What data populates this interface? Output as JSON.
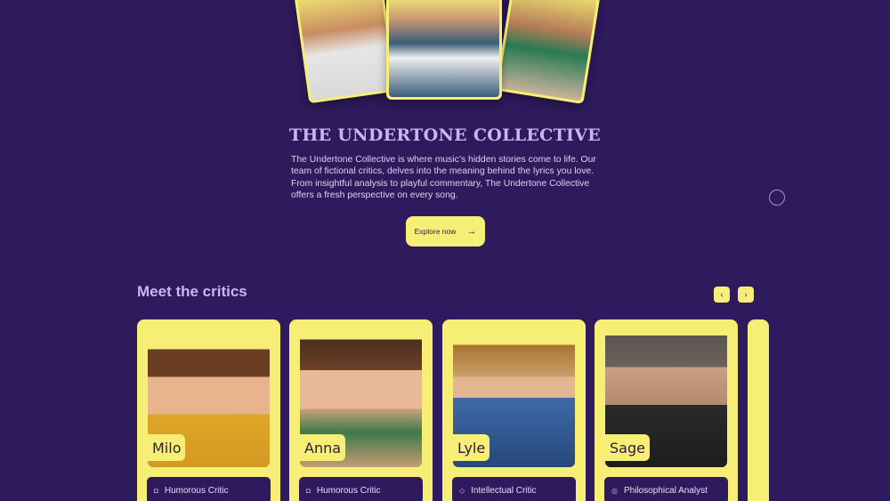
{
  "hero": {
    "title": "THE UNDERTONE COLLECTIVE",
    "description": "The Undertone Collective is where music’s hidden stories come to life. Our team of fictional critics, delves into the meaning behind the lyrics you love. From insightful analysis to playful commentary, The Undertone Collective offers a fresh perspective on every song.",
    "cta_label": "Explore now",
    "cta_icon": "→"
  },
  "critics": {
    "section_title": "Meet the critics",
    "prev_icon": "‹",
    "next_icon": "›",
    "cards": [
      {
        "name": "Milo",
        "role": "Humorous Critic",
        "role_icon": "◘"
      },
      {
        "name": "Anna",
        "role": "Humorous Critic",
        "role_icon": "◘"
      },
      {
        "name": "Lyle",
        "role": "Intellectual Critic",
        "role_icon": "◇"
      },
      {
        "name": "Sage",
        "role": "Philosophical Analyst",
        "role_icon": "◎"
      }
    ]
  },
  "colors": {
    "background": "#2e1a5c",
    "accent": "#f7ef75",
    "title": "#c9b6f0"
  }
}
